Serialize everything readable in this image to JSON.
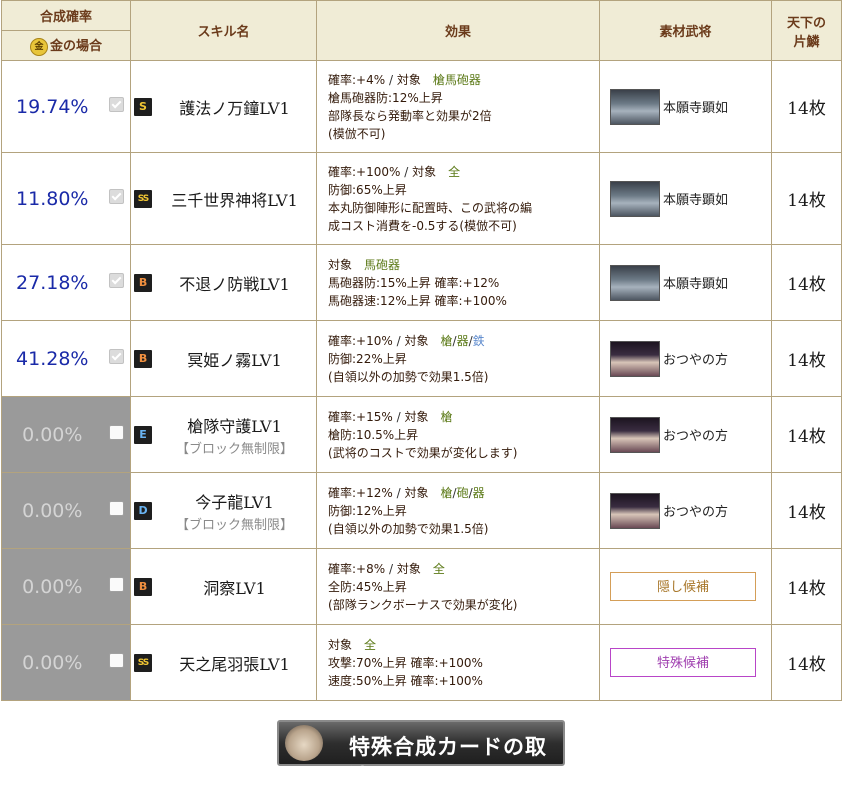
{
  "header": {
    "rate": "合成確率",
    "gold_case": "金の場合",
    "gold_icon": "金",
    "skill_name": "スキル名",
    "effect": "効果",
    "material": "素材武将",
    "count_title_1": "天下の",
    "count_title_2": "片鱗"
  },
  "rows": [
    {
      "rate": "19.74%",
      "checked": true,
      "disabled": true,
      "rank": "S",
      "skill": "護法ノ万鐘LV1",
      "note": "",
      "effect": [
        {
          "type": "target",
          "prefix": "確率:+4%",
          "label": "対象",
          "targets": [
            "槍馬砲器"
          ]
        },
        {
          "type": "text",
          "text": "槍馬砲器防:12%上昇"
        },
        {
          "type": "text",
          "text": "部隊長なら発動率と効果が2倍"
        },
        {
          "type": "text",
          "text": "(模倣不可)"
        }
      ],
      "material": {
        "kind": "portrait",
        "portrait": "monk-portrait",
        "name": "本願寺顕如"
      },
      "count": "14枚"
    },
    {
      "rate": "11.80%",
      "checked": true,
      "disabled": true,
      "rank": "SS",
      "skill": "三千世界神将LV1",
      "note": "",
      "effect": [
        {
          "type": "target",
          "prefix": "確率:+100%",
          "label": "対象",
          "targets": [
            "全"
          ]
        },
        {
          "type": "text",
          "text": "防御:65%上昇"
        },
        {
          "type": "text",
          "text": "本丸防御陣形に配置時、この武将の編"
        },
        {
          "type": "text",
          "text": "成コスト消費を-0.5する(模倣不可)"
        }
      ],
      "material": {
        "kind": "portrait",
        "portrait": "monk-portrait",
        "name": "本願寺顕如"
      },
      "count": "14枚"
    },
    {
      "rate": "27.18%",
      "checked": true,
      "disabled": true,
      "rank": "B",
      "skill": "不退ノ防戦LV1",
      "note": "",
      "effect": [
        {
          "type": "target",
          "prefix": "",
          "label": "対象",
          "targets": [
            "馬砲器"
          ]
        },
        {
          "type": "text",
          "text": "馬砲器防:15%上昇 確率:+12%"
        },
        {
          "type": "text",
          "text": "馬砲器速:12%上昇 確率:+100%"
        }
      ],
      "material": {
        "kind": "portrait",
        "portrait": "monk-portrait",
        "name": "本願寺顕如"
      },
      "count": "14枚"
    },
    {
      "rate": "41.28%",
      "checked": true,
      "disabled": true,
      "rank": "B",
      "skill": "冥姫ノ霧LV1",
      "note": "",
      "effect": [
        {
          "type": "target",
          "prefix": "確率:+10%",
          "label": "対象",
          "targets": [
            "槍",
            "器",
            "鉄"
          ]
        },
        {
          "type": "text",
          "text": "防御:22%上昇"
        },
        {
          "type": "text",
          "text": "(自領以外の加勢で効果1.5倍)"
        }
      ],
      "material": {
        "kind": "portrait",
        "portrait": "lady-portrait",
        "name": "おつやの方"
      },
      "count": "14枚"
    },
    {
      "rate": "0.00%",
      "checked": false,
      "disabled": false,
      "rank": "E",
      "skill": "槍隊守護LV1",
      "note": "【ブロック無制限】",
      "effect": [
        {
          "type": "target",
          "prefix": "確率:+15%",
          "label": "対象",
          "targets": [
            "槍"
          ]
        },
        {
          "type": "text",
          "text": "槍防:10.5%上昇"
        },
        {
          "type": "text",
          "text": "(武将のコストで効果が変化します)"
        }
      ],
      "material": {
        "kind": "portrait",
        "portrait": "lady-portrait",
        "name": "おつやの方"
      },
      "count": "14枚"
    },
    {
      "rate": "0.00%",
      "checked": false,
      "disabled": false,
      "rank": "D",
      "skill": "今子龍LV1",
      "note": "【ブロック無制限】",
      "effect": [
        {
          "type": "target",
          "prefix": "確率:+12%",
          "label": "対象",
          "targets": [
            "槍",
            "砲",
            "器"
          ]
        },
        {
          "type": "text",
          "text": "防御:12%上昇"
        },
        {
          "type": "text",
          "text": "(自領以外の加勢で効果1.5倍)"
        }
      ],
      "material": {
        "kind": "portrait",
        "portrait": "lady-portrait",
        "name": "おつやの方"
      },
      "count": "14枚"
    },
    {
      "rate": "0.00%",
      "checked": false,
      "disabled": false,
      "rank": "B",
      "skill": "洞察LV1",
      "note": "",
      "effect": [
        {
          "type": "target",
          "prefix": "確率:+8%",
          "label": "対象",
          "targets": [
            "全"
          ]
        },
        {
          "type": "text",
          "text": "全防:45%上昇"
        },
        {
          "type": "text",
          "text": "(部隊ランクボーナスで効果が変化)"
        }
      ],
      "material": {
        "kind": "button",
        "style": "hidden",
        "label": "隠し候補"
      },
      "count": "14枚"
    },
    {
      "rate": "0.00%",
      "checked": false,
      "disabled": false,
      "rank": "SS",
      "skill": "天之尾羽張LV1",
      "note": "",
      "effect": [
        {
          "type": "target",
          "prefix": "",
          "label": "対象",
          "targets": [
            "全"
          ]
        },
        {
          "type": "text",
          "text": "攻撃:70%上昇 確率:+100%"
        },
        {
          "type": "text",
          "text": "速度:50%上昇 確率:+100%"
        }
      ],
      "material": {
        "kind": "button",
        "style": "special",
        "label": "特殊候補"
      },
      "count": "14枚"
    }
  ],
  "colors": {
    "header_bg": "#f0ecd6",
    "border": "#b3a37e",
    "rate_blue": "#1a2aa8",
    "disabled_gray": "#9a9a9a",
    "target_green": "#5c7a18",
    "iron_blue": "#5a88cc",
    "hidden_orange": "#d49e58",
    "special_purple": "#b845c8"
  },
  "footer": {
    "cancel_label": "特殊合成カードの取消",
    "cancel_icon": "character-portrait-icon"
  }
}
